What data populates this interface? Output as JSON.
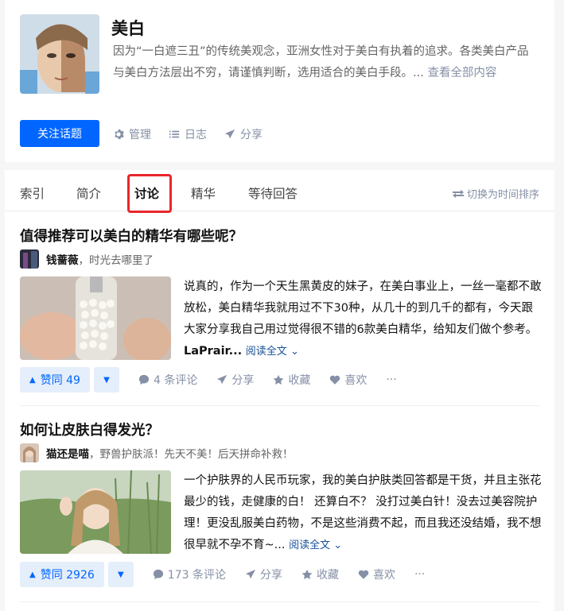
{
  "topic": {
    "title": "美白",
    "description": "因为“一白遮三丑”的传统美观念，亚洲女性对于美白有执着的追求。各类美白产品与美白方法层出不穷，请谨慎判断，选用适合的美白手段。...",
    "more_label": "查看全部内容",
    "follow_label": "关注话题",
    "actions": {
      "manage": "管理",
      "log": "日志",
      "share": "分享"
    }
  },
  "tabs": [
    "索引",
    "简介",
    "讨论",
    "精华",
    "等待回答"
  ],
  "active_tab": "讨论",
  "sort_toggle": "切换为时间排序",
  "feed": [
    {
      "question": "值得推荐可以美白的精华有哪些呢？",
      "author_name": "钱蔷薇",
      "author_bio": "，时光去哪里了",
      "excerpt": "说真的，作为一个天生黑黄皮的妹子，在美白事业上，一丝一毫都不敢放松，美白精华我就用过不下30种，从几十的到几千的都有，今天跟大家分享我自己用过觉得很不错的6款美白精华，给知友们做个参考。",
      "excerpt_bold": "LaPrair...",
      "read_more": "阅读全文",
      "vote_label": "赞同 49",
      "comments": "4 条评论",
      "share": "分享",
      "collect": "收藏",
      "like": "喜欢",
      "more": "···"
    },
    {
      "question": "如何让皮肤白得发光？",
      "author_name": "猫还是喵",
      "author_bio": "，野兽护肤派！先天不美！后天拼命补救！",
      "excerpt": "一个护肤界的人民币玩家，我的美白护肤类回答都是干货，并且主张花最少的钱，走健康的白！ 还算白不？ 没打过美白针！没去过美容院护理！更没乱服美白药物，不是这些消费不起，而且我还没结婚，我不想很早就不孕不育~...",
      "excerpt_bold": "",
      "read_more": "阅读全文",
      "vote_label": "赞同 2926",
      "comments": "173 条评论",
      "share": "分享",
      "collect": "收藏",
      "like": "喜欢",
      "more": "···"
    }
  ],
  "colors": {
    "accent": "#0066ff",
    "highlight_box": "#e8262b",
    "meta": "#8590a6"
  }
}
